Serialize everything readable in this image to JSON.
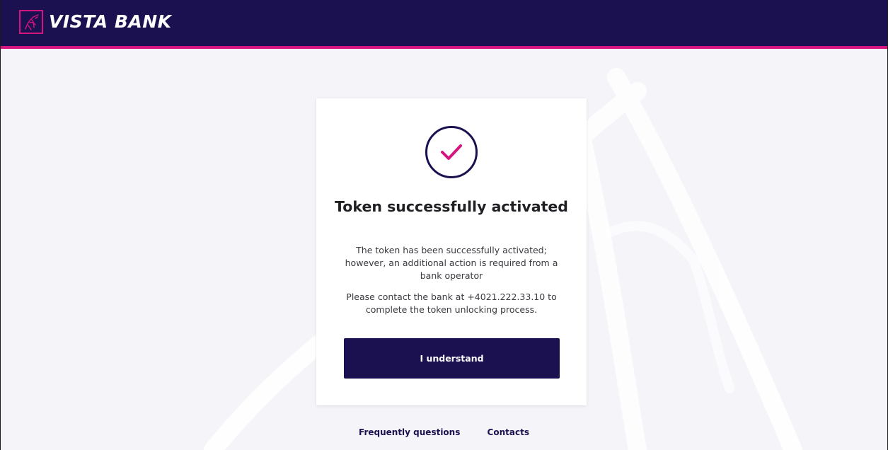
{
  "header": {
    "brand_name": "VISTA BANK",
    "logo_icon": "horse-logo-icon",
    "background_color": "#1c1150",
    "accent_color": "#d5157f"
  },
  "dialog": {
    "status_icon": "check-circle-icon",
    "title": "Token successfully activated",
    "description": "The token has been successfully activated; however, an additional action is required from a bank operator",
    "contact_text": "Please contact the bank at +4021.222.33.10 to complete the token unlocking process.",
    "confirm_button_label": "I understand",
    "button_color": "#1c1150",
    "check_color": "#d5157f"
  },
  "footer": {
    "links": [
      {
        "label": "Frequently questions"
      },
      {
        "label": "Contacts"
      }
    ]
  }
}
